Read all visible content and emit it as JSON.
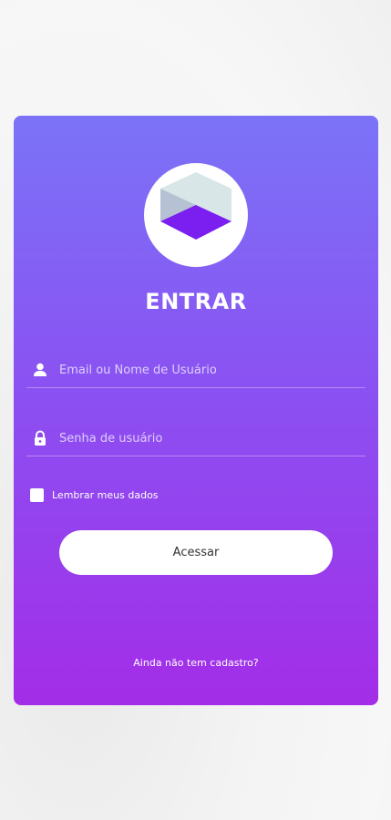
{
  "login": {
    "title": "ENTRAR",
    "username": {
      "placeholder": "Email ou Nome de Usuário",
      "icon": "user-icon"
    },
    "password": {
      "placeholder": "Senha de usuário",
      "icon": "lock-icon"
    },
    "remember_label": "Lembrar meus dados",
    "remember_checked": false,
    "submit_label": "Acessar",
    "signup_link": "Ainda não tem cadastro?"
  },
  "colors": {
    "gradient_top": "#7b73f7",
    "gradient_bottom": "#a32de8",
    "logo_accent": "#7a1ff0"
  }
}
